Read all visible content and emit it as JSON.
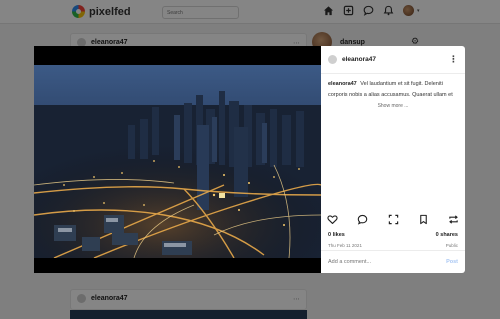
{
  "navbar": {
    "brand": "pixelfed",
    "search_placeholder": "Search"
  },
  "feed": {
    "top_post_user": "eleanora47",
    "bottom_post_user": "eleanora47",
    "sidebar_user": "dansup"
  },
  "modal": {
    "username": "eleanora47",
    "caption": "Vel laudantium et sit fugit. Deleniti corporis nobis a alias accusamus. Quaerat ullam et",
    "show_more": "Show more ...",
    "likes": "0 likes",
    "shares": "0 shares",
    "date": "Thu Feb 11 2021",
    "visibility": "Public",
    "comment_placeholder": "Add a comment...",
    "post_label": "Post"
  },
  "colors": {
    "post_button": "#a9c7f3",
    "overlay": "rgba(0,0,0,0.48)"
  }
}
